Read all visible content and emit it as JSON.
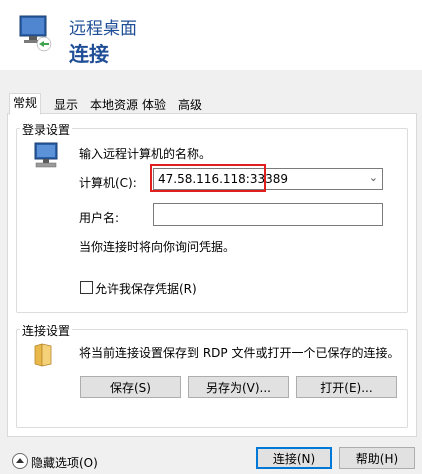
{
  "header": {
    "title_line1": "远程桌面",
    "title_line2": "连接"
  },
  "tabs": [
    {
      "label": "常规",
      "active": true
    },
    {
      "label": "显示",
      "active": false
    },
    {
      "label": "本地资源",
      "active": false
    },
    {
      "label": "体验",
      "active": false
    },
    {
      "label": "高级",
      "active": false
    }
  ],
  "login": {
    "group_title": "登录设置",
    "prompt": "输入远程计算机的名称。",
    "computer_label": "计算机(C):",
    "computer_value": "47.58.116.118:33389",
    "username_label": "用户名:",
    "username_value": "",
    "credential_note": "当你连接时将向你询问凭据。",
    "save_credentials_label": "允许我保存凭据(R)"
  },
  "connection": {
    "group_title": "连接设置",
    "description": "将当前连接设置保存到 RDP 文件或打开一个已保存的连接。",
    "save_label": "保存(S)",
    "save_as_label": "另存为(V)...",
    "open_label": "打开(E)..."
  },
  "footer": {
    "hide_options_label": "隐藏选项(O)",
    "connect_label": "连接(N)",
    "help_label": "帮助(H)"
  },
  "colors": {
    "title_blue": "#1f4e96",
    "highlight_red": "#e02020",
    "default_button_border": "#0078d7"
  }
}
